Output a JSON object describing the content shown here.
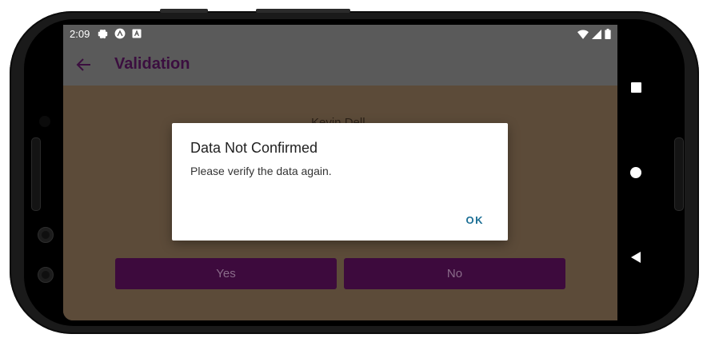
{
  "statusbar": {
    "time": "2:09",
    "icons": [
      "gear-icon",
      "app-icon",
      "notification-icon"
    ],
    "right_icons": [
      "wifi-icon",
      "signal-icon",
      "battery-icon"
    ]
  },
  "appbar": {
    "title": "Validation",
    "back_icon": "back-arrow-icon"
  },
  "content": {
    "label_behind_dialog": "Kevin Dell",
    "yes_label": "Yes",
    "no_label": "No"
  },
  "dialog": {
    "title": "Data Not Confirmed",
    "message": "Please verify the data again.",
    "ok_label": "OK"
  },
  "colors": {
    "scrim_content": "#5c4b39",
    "appbar": "#5a5a5a",
    "title": "#3b0e3f",
    "button_bg": "#3d0a3d",
    "dialog_action": "#1c6f95"
  }
}
